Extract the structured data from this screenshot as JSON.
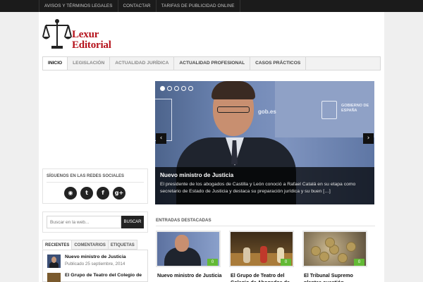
{
  "topbar": {
    "links": [
      "AVISOS Y TÉRMINOS LEGALES",
      "CONTACTAR",
      "TARIFAS DE PUBLICIDAD ONLINE"
    ]
  },
  "logo": {
    "line1": "Lexur",
    "line2": "Editorial"
  },
  "nav": {
    "items": [
      "INICIO",
      "LEGISLACIÓN",
      "ACTUALIDAD JURÍDICA",
      "ACTUALIDAD PROFESIONAL",
      "CASOS PRÁCTICOS"
    ],
    "active_index": 0
  },
  "slider": {
    "dots_total": 5,
    "active_dot": 1,
    "prev_arrow": "‹",
    "next_arrow": "›",
    "image_text": "gob.es",
    "ministry_text": "GOBIERNO DE ESPAÑA",
    "title": "Nuevo ministro de Justicia",
    "excerpt": "El presidente de los abogados de Castilla y León conoció a Rafael Catalá en su etapa como secretario de Estado de Justicia y destaca su preparación jurídica y su buen […]"
  },
  "social": {
    "title": "SÍGUENOS EN LAS REDES SOCIALES",
    "icons": [
      {
        "name": "rss-icon",
        "glyph": "◉"
      },
      {
        "name": "twitter-icon",
        "glyph": "t"
      },
      {
        "name": "facebook-icon",
        "glyph": "f"
      },
      {
        "name": "googleplus-icon",
        "glyph": "g+"
      }
    ]
  },
  "search": {
    "placeholder": "Buscar en la web...",
    "button": "BUSCAR"
  },
  "tabs": {
    "items": [
      "RECIENTES",
      "COMENTARIOS",
      "ETIQUETAS"
    ],
    "active_index": 0
  },
  "recent": [
    {
      "title": "Nuevo ministro de Justicia",
      "date": "Publicado 25 septiembre, 2014"
    },
    {
      "title": "El Grupo de Teatro del Colegio de",
      "date": ""
    }
  ],
  "featured": {
    "heading": "ENTRADAS DESTACADAS",
    "items": [
      {
        "title": "Nuevo ministro de Justicia",
        "comments": "0"
      },
      {
        "title": "El Grupo de Teatro del Colegio de Abogados de",
        "comments": "0"
      },
      {
        "title": "El Tribunal Supremo plantea cuestión",
        "comments": "0"
      }
    ]
  },
  "colors": {
    "brand_red": "#b5121b",
    "topbar": "#1b1b1b",
    "badge_green": "#63b935"
  }
}
